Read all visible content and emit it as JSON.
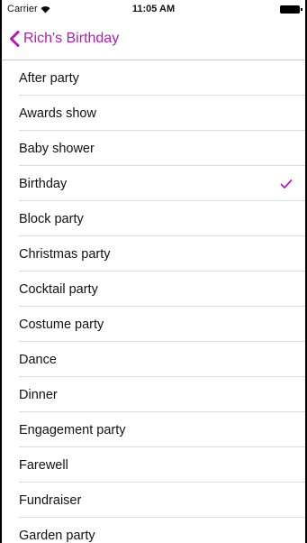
{
  "status": {
    "carrier": "Carrier",
    "time": "11:05 AM"
  },
  "nav": {
    "back_label": "Rich's Birthday"
  },
  "colors": {
    "accent": "#b21ab8"
  },
  "items": [
    {
      "label": "After party",
      "checked": false
    },
    {
      "label": "Awards show",
      "checked": false
    },
    {
      "label": "Baby shower",
      "checked": false
    },
    {
      "label": "Birthday",
      "checked": true
    },
    {
      "label": "Block party",
      "checked": false
    },
    {
      "label": "Christmas party",
      "checked": false
    },
    {
      "label": "Cocktail party",
      "checked": false
    },
    {
      "label": "Costume party",
      "checked": false
    },
    {
      "label": "Dance",
      "checked": false
    },
    {
      "label": "Dinner",
      "checked": false
    },
    {
      "label": "Engagement party",
      "checked": false
    },
    {
      "label": "Farewell",
      "checked": false
    },
    {
      "label": "Fundraiser",
      "checked": false
    },
    {
      "label": "Garden party",
      "checked": false
    }
  ]
}
